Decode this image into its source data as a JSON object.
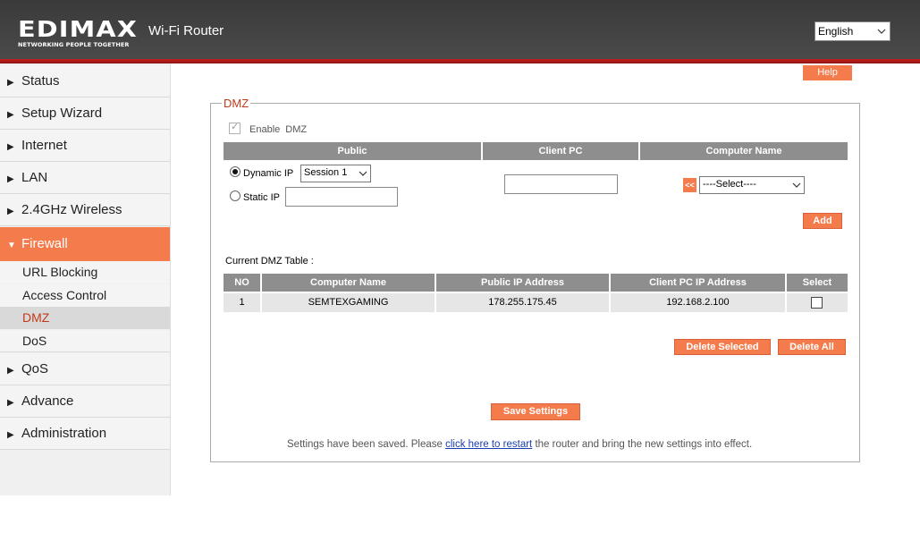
{
  "header": {
    "logo_text": "EDIMAX",
    "logo_tagline": "NETWORKING PEOPLE TOGETHER",
    "app_title": "Wi-Fi Router",
    "language": "English"
  },
  "sidebar": {
    "items": [
      {
        "label": "Status"
      },
      {
        "label": "Setup Wizard"
      },
      {
        "label": "Internet"
      },
      {
        "label": "LAN"
      },
      {
        "label": "2.4GHz Wireless"
      },
      {
        "label": "Firewall"
      },
      {
        "label": "QoS"
      },
      {
        "label": "Advance"
      },
      {
        "label": "Administration"
      }
    ],
    "firewall_sub": [
      {
        "label": "URL Blocking"
      },
      {
        "label": "Access Control"
      },
      {
        "label": "DMZ"
      },
      {
        "label": "DoS"
      }
    ]
  },
  "help_label": "Help",
  "dmz": {
    "legend": "DMZ",
    "enable_label": "Enable  DMZ",
    "enable_checked": true,
    "headers": {
      "public": "Public",
      "client_pc": "Client PC",
      "computer_name": "Computer Name"
    },
    "dynamic_ip_label": "Dynamic IP",
    "static_ip_label": "Static IP",
    "session_value": "Session  1",
    "static_ip_value": "",
    "client_pc_value": "",
    "arrow_button": "<<",
    "computer_select": "----Select----",
    "add_label": "Add",
    "current_table_label": "Current DMZ Table :",
    "table_headers": [
      "NO",
      "Computer Name",
      "Public  IP Address",
      "Client PC  IP Address",
      "Select"
    ],
    "rows": [
      {
        "no": "1",
        "computer_name": "SEMTEXGAMING",
        "public_ip": "178.255.175.45",
        "client_ip": "192.168.2.100"
      }
    ],
    "delete_selected_label": "Delete Selected",
    "delete_all_label": "Delete All",
    "save_label": "Save Settings",
    "status_before": "Settings have been saved. Please ",
    "status_link": "click here to restart",
    "status_after": " the router and bring the new settings into effect."
  },
  "colors": {
    "accent": "#f47c4c",
    "header_bg": "#3f3f3f",
    "header_line": "#c81e1e",
    "table_header": "#8e8e8e"
  }
}
